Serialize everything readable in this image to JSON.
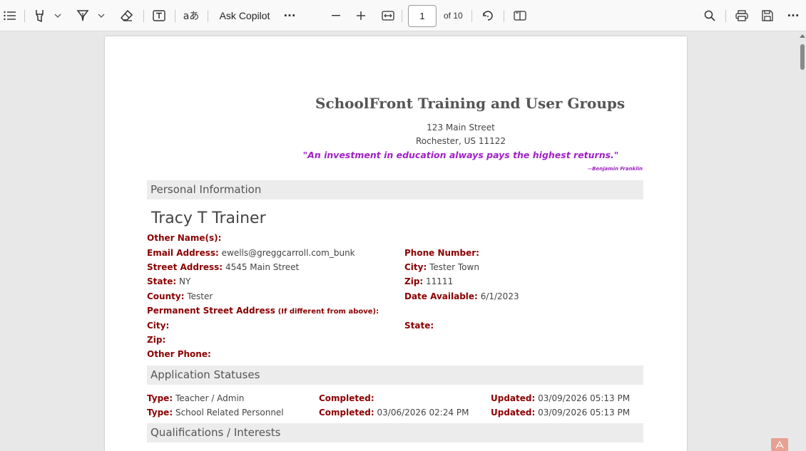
{
  "toolbar": {
    "contents_icon": "list-icon",
    "highlight_icon": "highlighter-icon",
    "draw_icon": "pen-icon",
    "erase_icon": "eraser-icon",
    "text_icon": "text-box-icon",
    "read_aloud_label": "aあ",
    "ask_copilot_label": "Ask Copilot",
    "more_label": "···",
    "current_page": "1",
    "page_of": "of 10",
    "actions_more_label": "···"
  },
  "document": {
    "org_title": "SchoolFront Training and User Groups",
    "address_line1": "123 Main Street",
    "address_line2": "Rochester, US 11122",
    "quote": "\"An investment in education always pays the highest returns.\"",
    "quote_author": "--Benjamin Franklin",
    "personal_info_heading": "Personal Information",
    "applicant_name": "Tracy T Trainer",
    "fields": {
      "other_names_label": "Other Name(s):",
      "other_names_value": "",
      "email_label": "Email Address:",
      "email_value": "ewells@greggcarroll.com_bunk",
      "phone_label": "Phone Number:",
      "phone_value": "",
      "street_label": "Street Address:",
      "street_value": "4545 Main Street",
      "city_label": "City:",
      "city_value": "Tester Town",
      "state_label": "State:",
      "state_value": "NY",
      "zip_label": "Zip:",
      "zip_value": "11111",
      "county_label": "County:",
      "county_value": "Tester",
      "date_available_label": "Date Available:",
      "date_available_value": "6/1/2023",
      "perm_street_label": "Permanent Street Address",
      "perm_street_note": "(If different from above):",
      "perm_city_label": "City:",
      "perm_state_label": "State:",
      "perm_zip_label": "Zip:",
      "other_phone_label": "Other Phone:"
    },
    "app_status_heading": "Application Statuses",
    "statuses": [
      {
        "type_label": "Type:",
        "type_value": "Teacher / Admin",
        "completed_label": "Completed:",
        "completed_value": "",
        "updated_label": "Updated:",
        "updated_value": "03/09/2026 05:13 PM"
      },
      {
        "type_label": "Type:",
        "type_value": "School Related Personnel",
        "completed_label": "Completed:",
        "completed_value": "03/06/2026 02:24 PM",
        "updated_label": "Updated:",
        "updated_value": "03/09/2026 05:13 PM"
      }
    ],
    "qualifications_heading": "Qualifications / Interests"
  }
}
